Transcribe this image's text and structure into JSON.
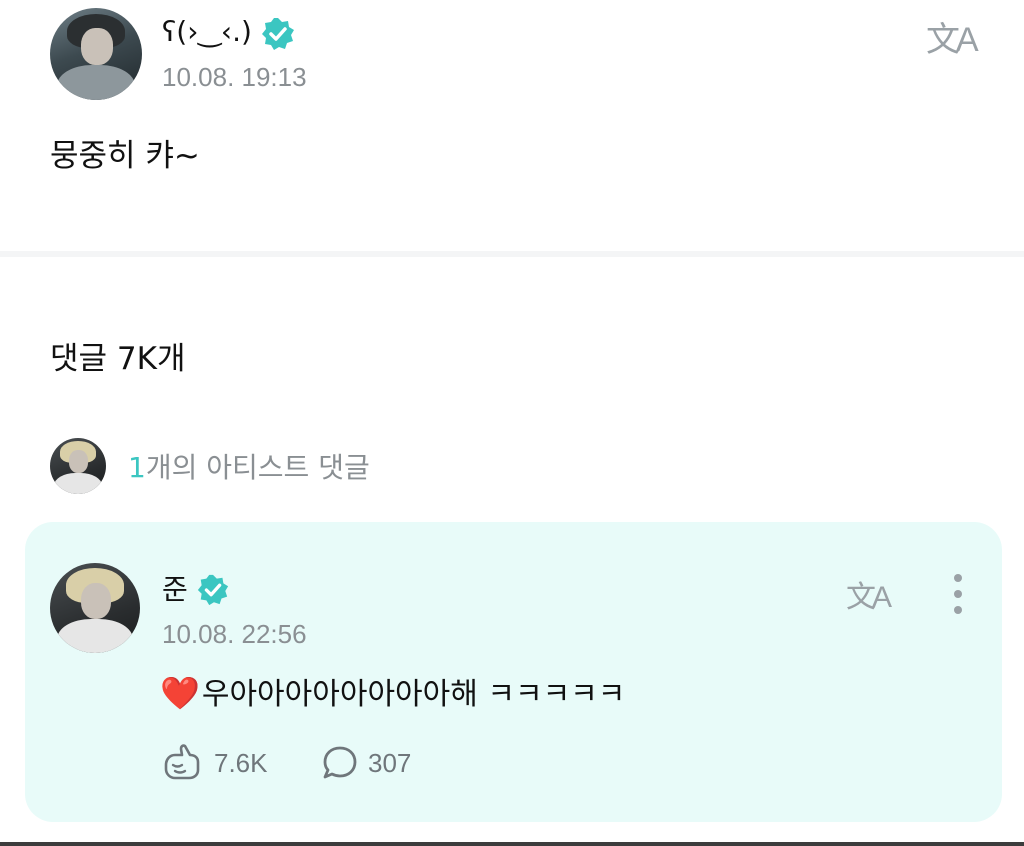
{
  "post": {
    "author_name": "ʕ(›‿‹.)",
    "timestamp": "10.08. 19:13",
    "body": "뭉중히 캬~",
    "translate_icon": "translate-icon"
  },
  "comments": {
    "count_label": "댓글 7K개",
    "artist_summary": {
      "count": "1",
      "label": "개의 아티스트 댓글"
    }
  },
  "artist_comment": {
    "author_name": "준",
    "timestamp": "10.08. 22:56",
    "heart_emoji": "❤️",
    "text": "우아아아아아아아아해 ㅋㅋㅋㅋㅋ",
    "likes": "7.6K",
    "replies": "307",
    "translate_icon": "translate-icon",
    "more_icon": "kebab-menu-icon"
  },
  "colors": {
    "accent": "#3bc6c1",
    "card_background": "#e8fbf9",
    "muted_text": "#8a8f93",
    "heart": "#e0141e"
  }
}
